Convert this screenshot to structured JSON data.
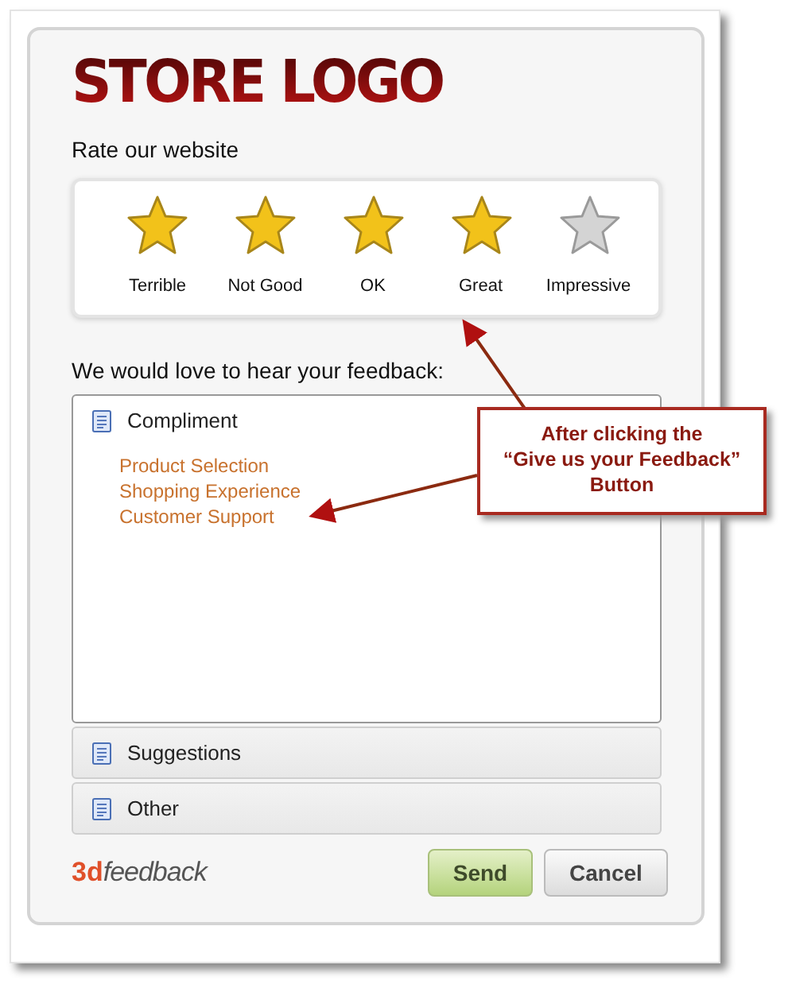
{
  "logo": "STORE LOGO",
  "rating": {
    "prompt": "Rate our website",
    "stars": 4,
    "options": [
      "Terrible",
      "Not Good",
      "OK",
      "Great",
      "Impressive"
    ]
  },
  "feedback": {
    "prompt": "We would love to hear your feedback:",
    "sections": [
      {
        "title": "Compliment",
        "expanded": true,
        "items": [
          "Product Selection",
          "Shopping Experience",
          "Customer Support"
        ]
      },
      {
        "title": "Suggestions",
        "expanded": false
      },
      {
        "title": "Other",
        "expanded": false
      }
    ]
  },
  "brand": {
    "mark": "3d",
    "name": "feedback"
  },
  "buttons": [
    {
      "kind": "primary",
      "label": "Send"
    },
    {
      "kind": "secondary",
      "label": "Cancel"
    }
  ],
  "callout": {
    "text": "After clicking the\n“Give us your Feedback”\nButton"
  }
}
